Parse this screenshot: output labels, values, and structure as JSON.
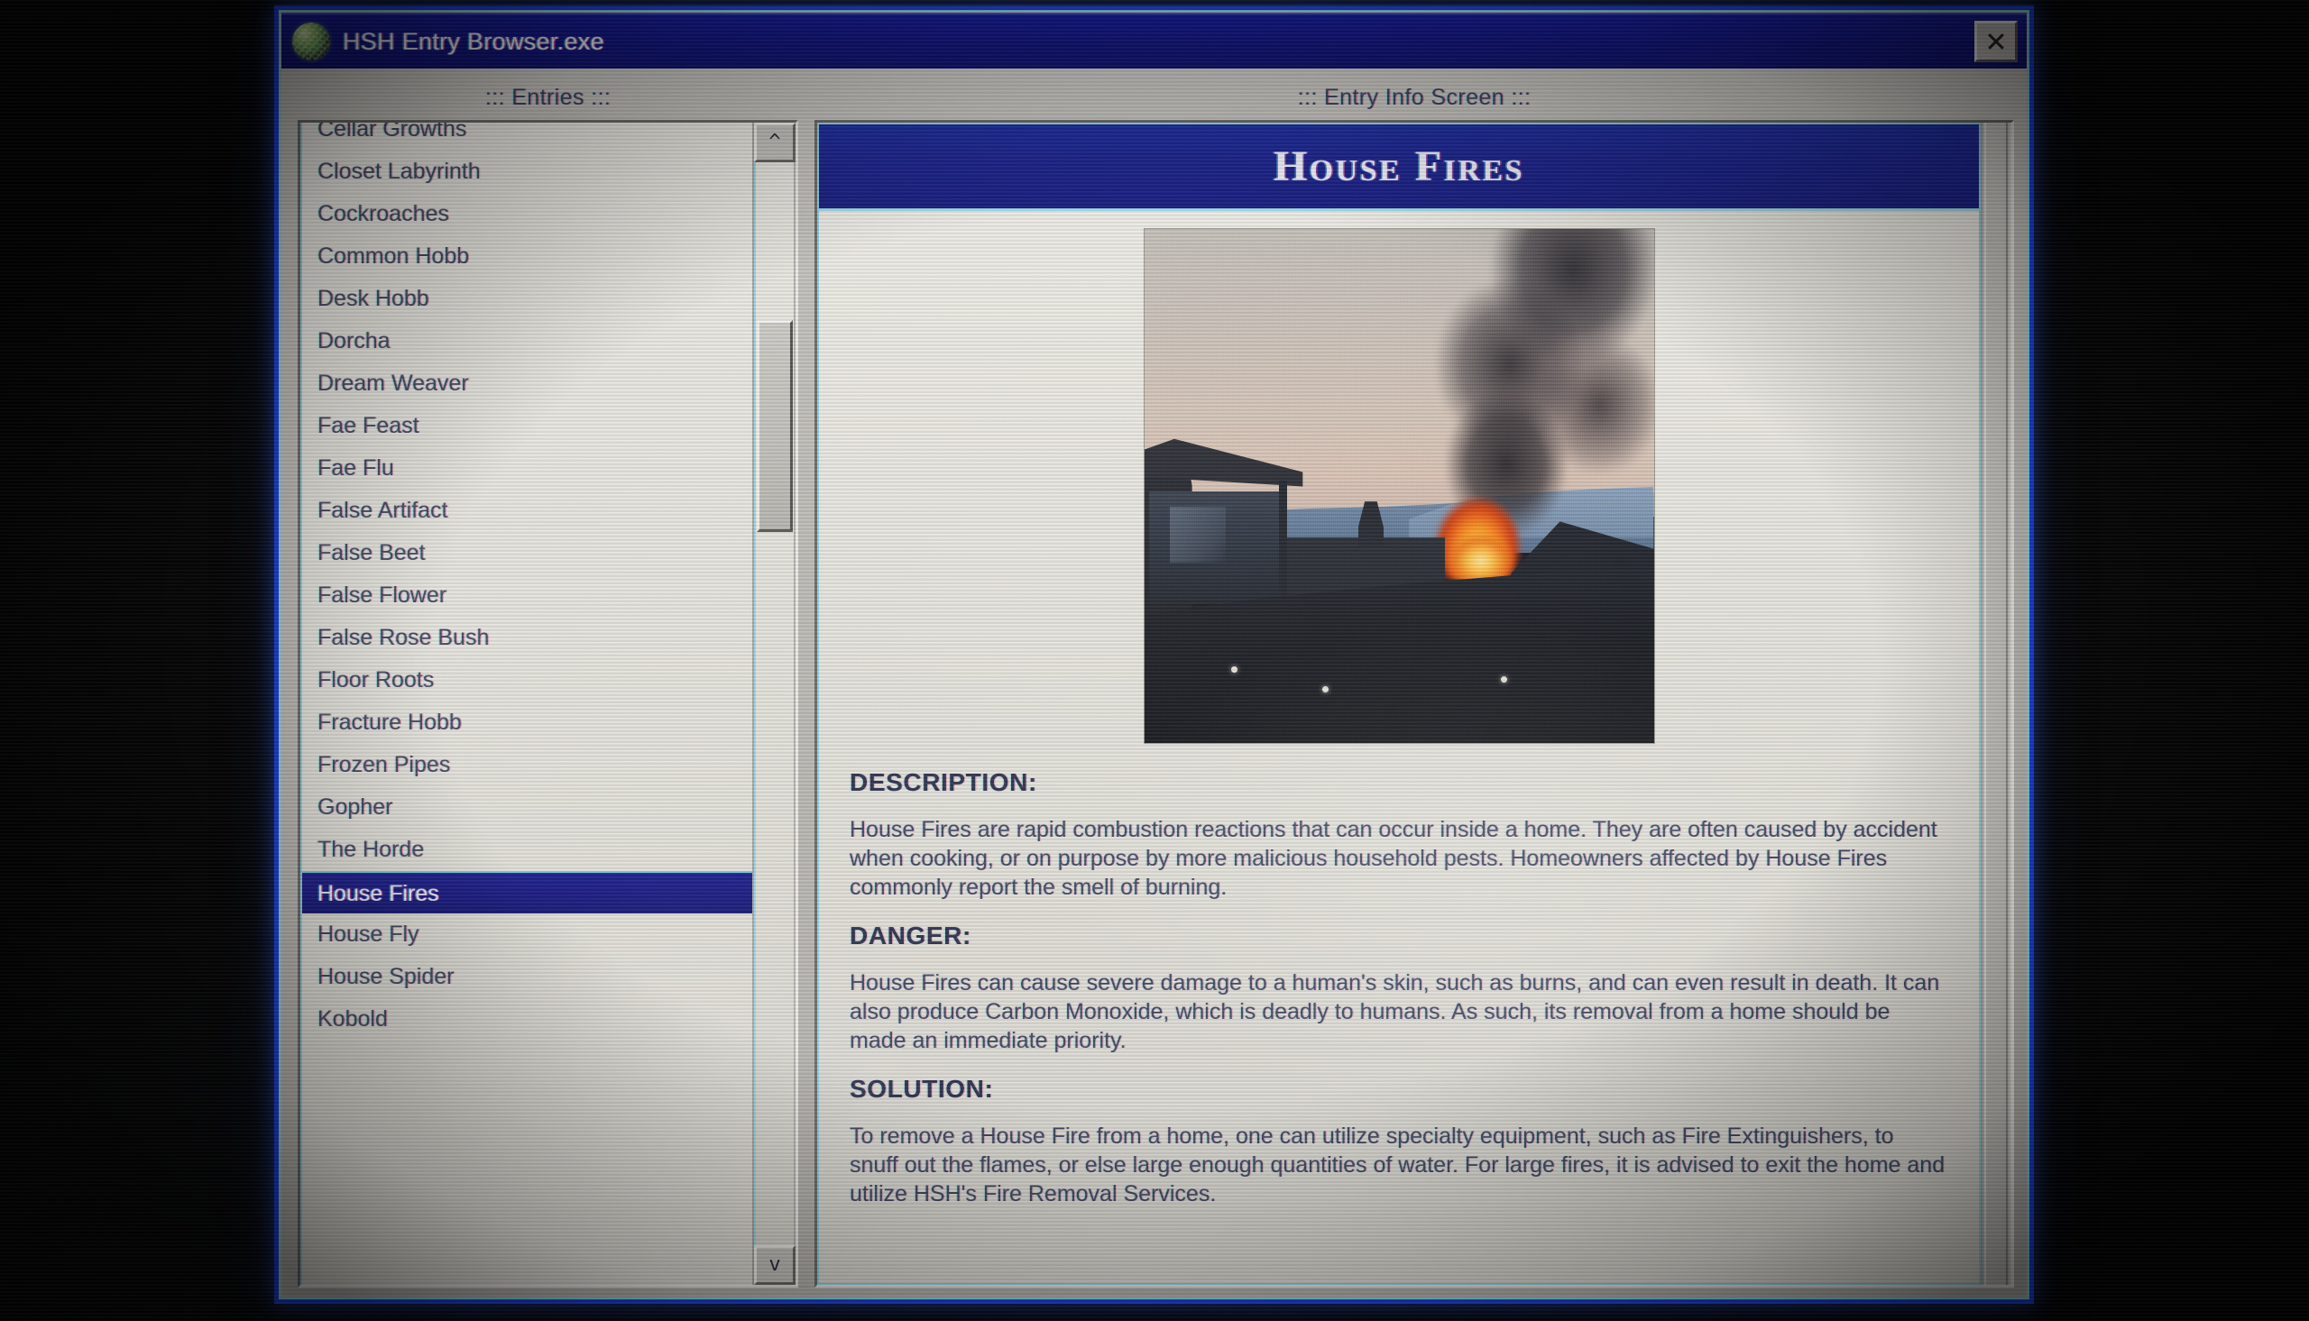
{
  "window": {
    "title": "HSH Entry Browser.exe",
    "icon": "globe-icon",
    "close_label": "close-icon",
    "accent_blue": "#1b3ddc",
    "titlebar_blue": "#101380",
    "banner_blue": "#1a2390",
    "selection_blue": "#1b1c84",
    "panel_gray": "#c2c0bb"
  },
  "left_pane": {
    "heading": "::: Entries :::",
    "scrollbar": {
      "up_arrow": "^",
      "down_arrow": "v"
    },
    "entries": [
      "Cellar Growths",
      "Closet Labyrinth",
      "Cockroaches",
      "Common Hobb",
      "Desk Hobb",
      "Dorcha",
      "Dream Weaver",
      "Fae Feast",
      "Fae Flu",
      "False Artifact",
      "False Beet",
      "False Flower",
      "False Rose Bush",
      "Floor Roots",
      "Fracture Hobb",
      "Frozen Pipes",
      "Gopher",
      "The Horde",
      "House Fires",
      "House Fly",
      "House Spider",
      "Kobold"
    ],
    "selected_entry": "House Fires"
  },
  "right_pane": {
    "heading": "::: Entry Info Screen :::",
    "banner_title": "House Fires",
    "photo_caption": "burning-house-photo",
    "sections": [
      {
        "heading": "DESCRIPTION:",
        "body": "House Fires are rapid combustion reactions that can occur inside a home. They are often caused by accident when cooking, or on purpose by more malicious household pests. Homeowners affected by House Fires commonly report the smell of burning."
      },
      {
        "heading": "DANGER:",
        "body": "House Fires can cause severe damage to a human's skin, such as burns, and can even result in death. It can also produce Carbon Monoxide, which is deadly to humans. As such, its removal from a home should be made an immediate priority."
      },
      {
        "heading": "SOLUTION:",
        "body": "To remove a House Fire from a home, one can utilize specialty equipment, such as Fire Extinguishers, to snuff out the flames, or else large enough quantities of water. For large fires, it is advised to exit the home and utilize HSH's Fire Removal Services."
      }
    ]
  }
}
